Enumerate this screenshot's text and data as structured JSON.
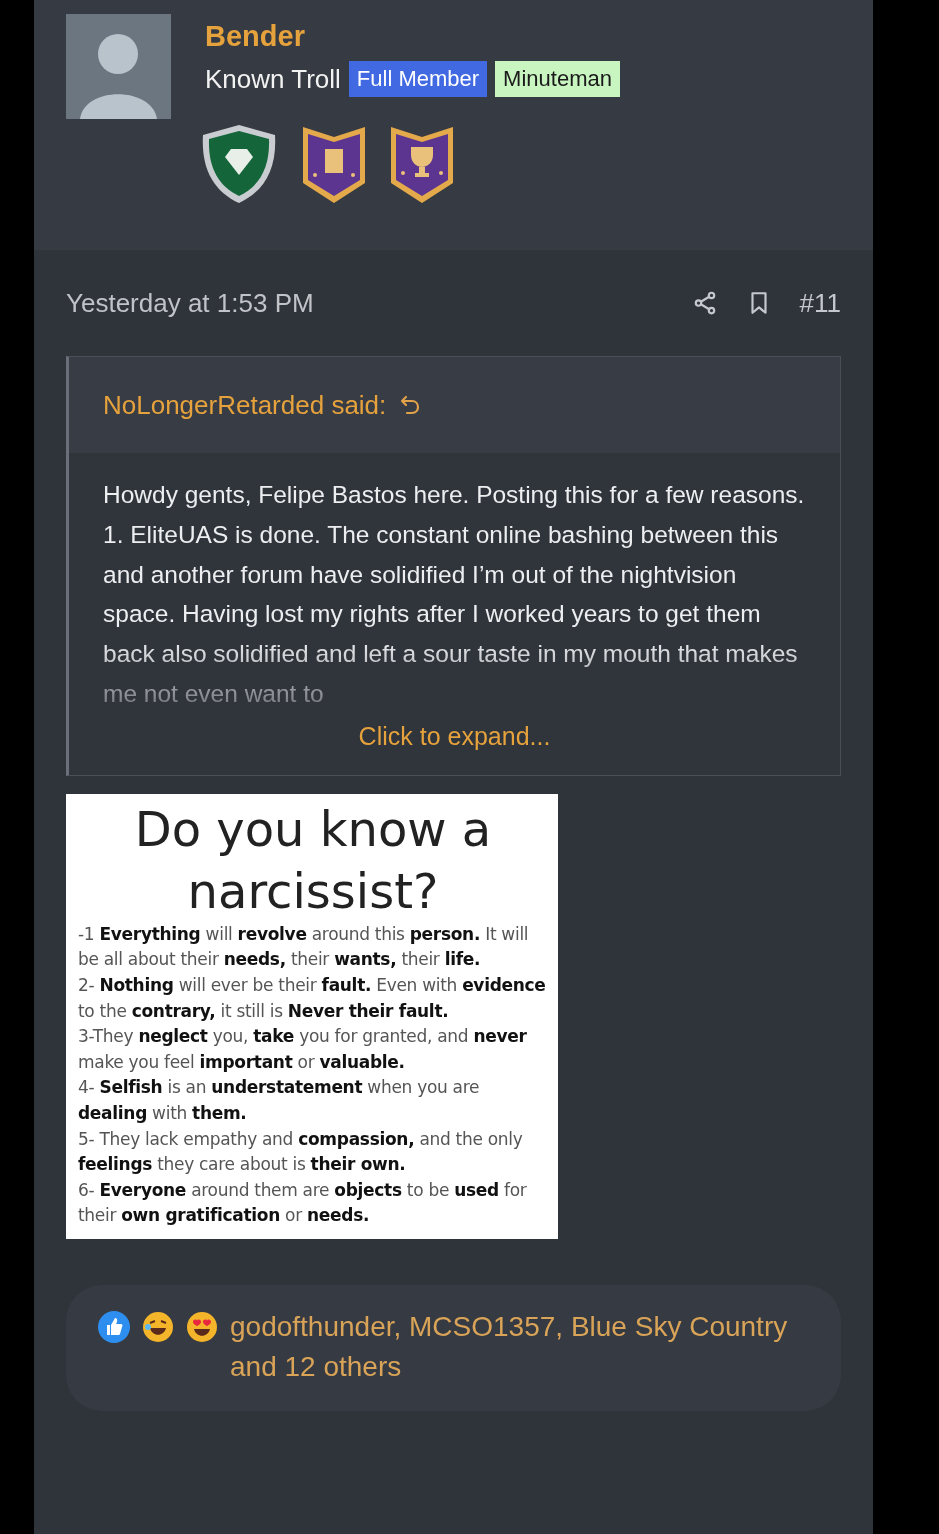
{
  "user": {
    "name": "Bender",
    "title": "Known Troll",
    "banners": [
      {
        "label": "Full Member",
        "color": "#4169e1"
      },
      {
        "label": "Minuteman",
        "color": "#c9f5c1"
      }
    ],
    "badges": [
      {
        "kind": "diamond"
      },
      {
        "kind": "vest"
      },
      {
        "kind": "trophy"
      }
    ]
  },
  "post": {
    "date": "Yesterday at 1:53 PM",
    "number": "#11",
    "quote": {
      "author": "NoLongerRetarded said:",
      "paragraphs": [
        "Howdy gents, Felipe Bastos here. Posting this for a few reasons.",
        "1. EliteUAS is done. The constant online bashing between this and another forum have solidified I’m out of the nightvision space. Having lost my rights after I worked years to get them back also solidified and left a sour taste in my mouth that makes me not even want to"
      ],
      "expand": "Click to expand..."
    },
    "attachment": {
      "title": "Do you know a narcissist?",
      "items": [
        "-1 **Everything** will **revolve** around this **person.** It will be all about their **needs,** their **wants,** their **life.**",
        "2- **Nothing** will ever be their **fault.** Even with **evidence** to the **contrary,** it still is **Never their fault.**",
        "3-They **neglect** you, **take** you for granted, and **never** make you feel **important** or **valuable.**",
        "4- **Selfish** is an **understatement** when you are **dealing** with **them.**",
        "5- They lack empathy and **compassion,** and the only **feelings** they care about is **their own.**",
        "6- **Everyone** around them are **objects** to be **used** for their **own gratification** or **needs.**"
      ]
    },
    "reactions": {
      "icons": [
        {
          "kind": "like"
        },
        {
          "kind": "laugh"
        },
        {
          "kind": "love"
        }
      ],
      "text": "godofthunder, MCSO1357, Blue Sky Country and 12 others"
    }
  }
}
